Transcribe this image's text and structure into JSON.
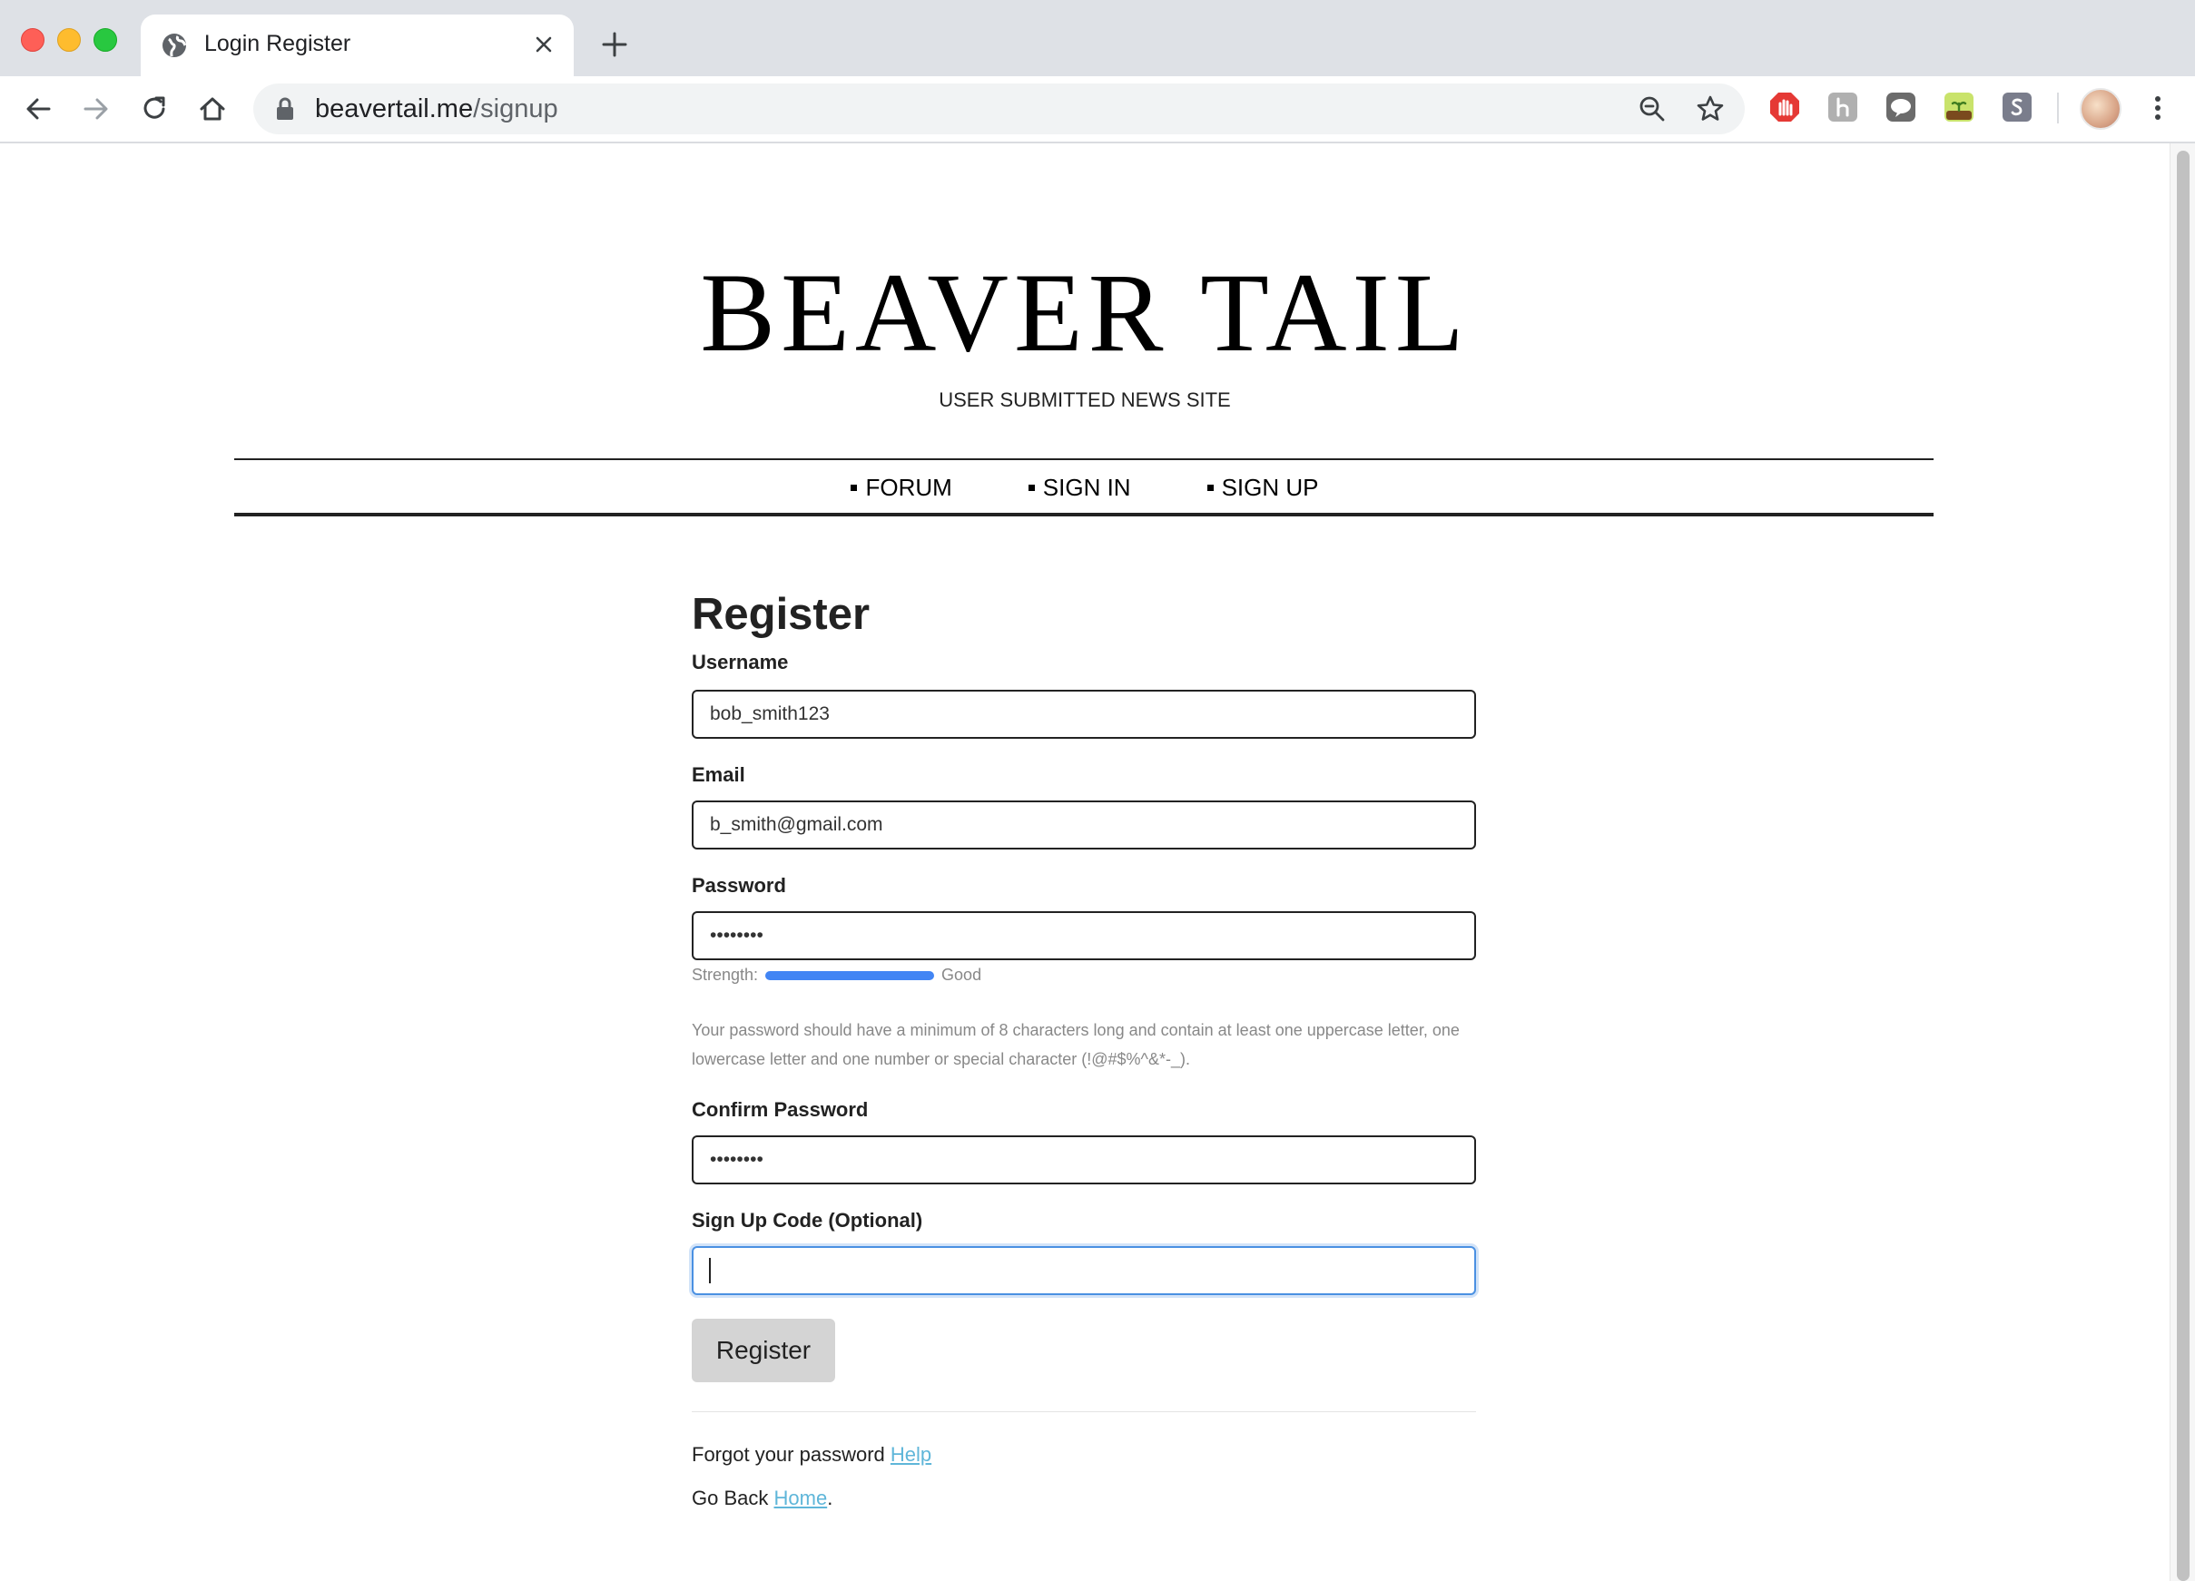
{
  "browser": {
    "tab_title": "Login Register",
    "url_domain": "beavertail.me",
    "url_path": "/signup"
  },
  "site": {
    "title": "BEAVER TAIL",
    "tagline": "USER SUBMITTED NEWS SITE"
  },
  "nav": {
    "forum": "FORUM",
    "sign_in": "SIGN IN",
    "sign_up": "SIGN UP"
  },
  "form": {
    "heading": "Register",
    "username_label": "Username",
    "username_value": "bob_smith123",
    "email_label": "Email",
    "email_value": "b_smith@gmail.com",
    "password_label": "Password",
    "password_value": "••••••••",
    "strength_label": "Strength:",
    "strength_text": "Good",
    "strength_level": 1.0,
    "password_hint": "Your password should have a minimum of 8 characters long and contain at least one uppercase letter, one lowercase letter and one number or special character (!@#$%^&*-_).",
    "confirm_label": "Confirm Password",
    "confirm_value": "••••••••",
    "code_label": "Sign Up Code (Optional)",
    "code_value": "",
    "submit_label": "Register"
  },
  "footer": {
    "forgot_text": "Forgot your password",
    "forgot_link": "Help",
    "back_text": "Go Back",
    "back_link": "Home",
    "back_suffix": "."
  },
  "colors": {
    "accent_blue": "#4285f4",
    "link": "#5fb6d9",
    "focus_border": "#4a90e2"
  }
}
